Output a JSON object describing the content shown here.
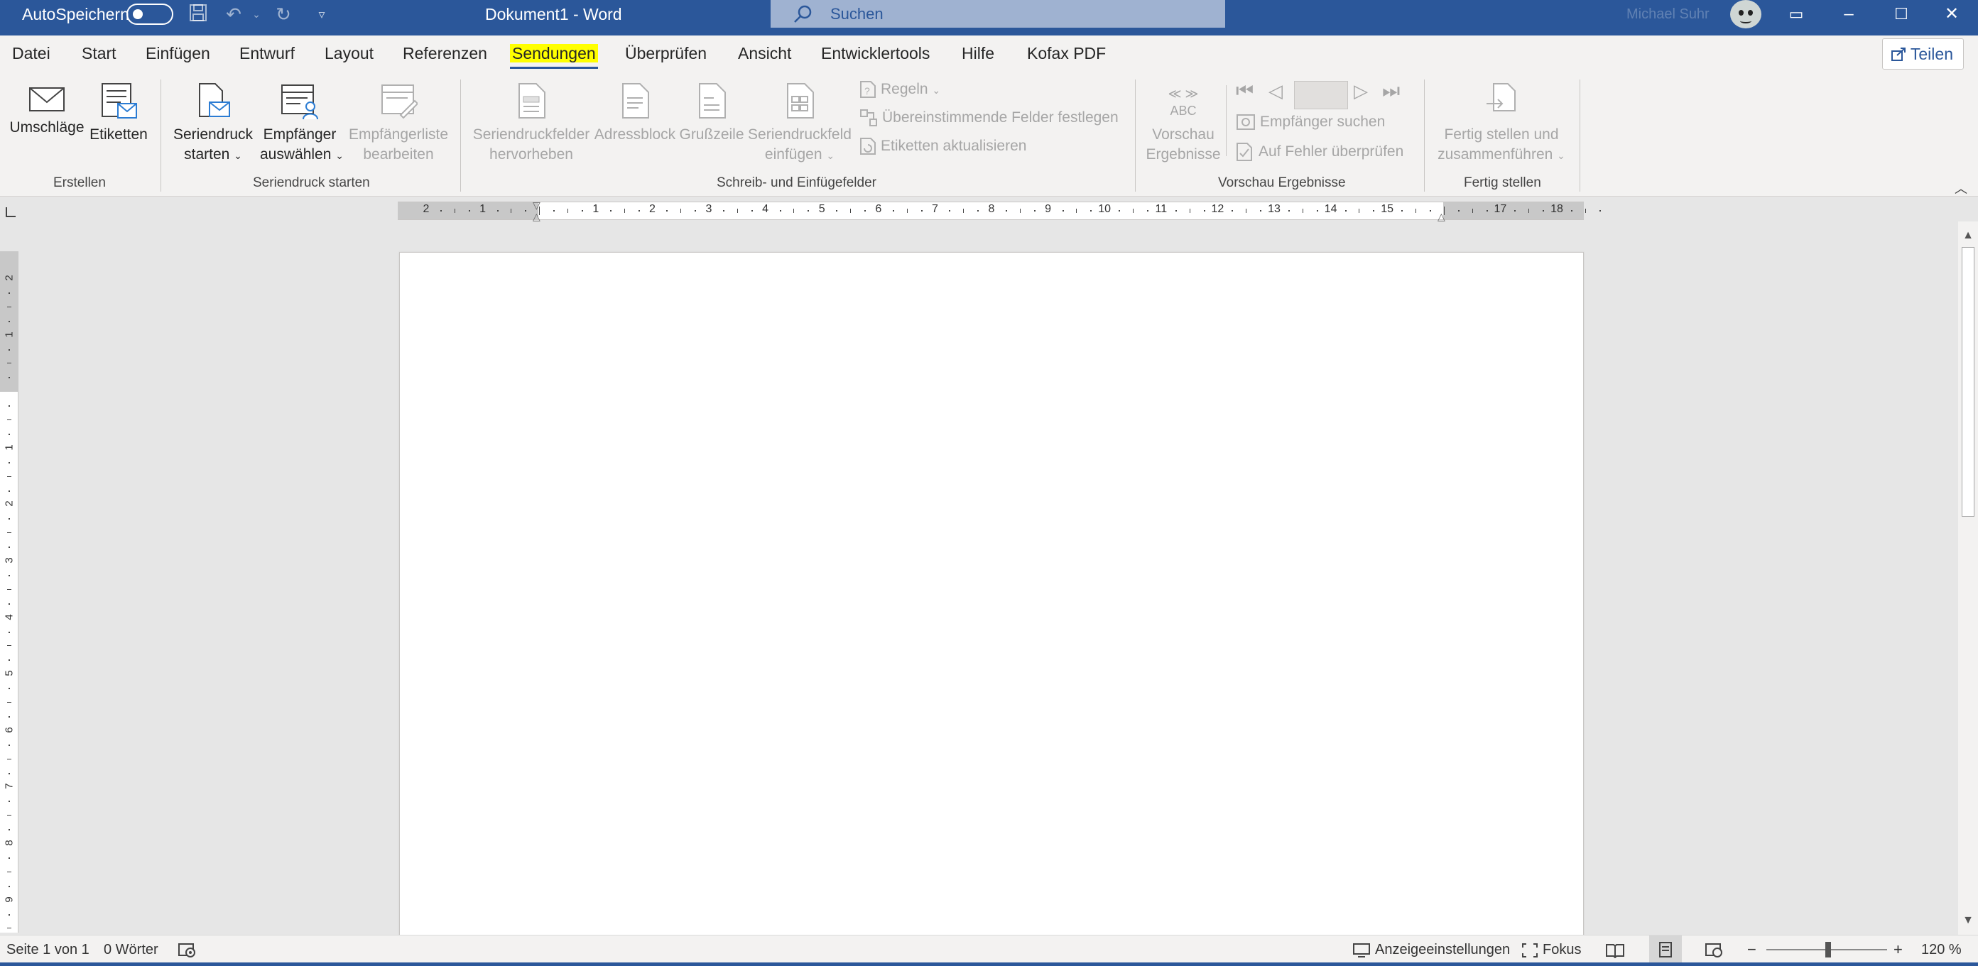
{
  "titlebar": {
    "autosave_label": "AutoSpeichern",
    "doc_title": "Dokument1  -  Word",
    "search_placeholder": "Suchen",
    "user_name": "Michael Suhr",
    "icons": [
      "save-icon",
      "undo-icon",
      "redo-icon",
      "customize-qat-icon",
      "ribbon-display-icon",
      "minimize-icon",
      "maximize-icon",
      "close-icon"
    ],
    "accent": "#2b579a"
  },
  "menu": {
    "tabs": [
      "Datei",
      "Start",
      "Einfügen",
      "Entwurf",
      "Layout",
      "Referenzen",
      "Sendungen",
      "Überprüfen",
      "Ansicht",
      "Entwicklertools",
      "Hilfe",
      "Kofax PDF"
    ],
    "active": "Sendungen",
    "highlight_color": "#ffff00",
    "share_label": "Teilen"
  },
  "ribbon": {
    "groups": {
      "erstellen": "Erstellen",
      "seriendruck_starten": "Seriendruck starten",
      "schreib": "Schreib- und Einfügefelder",
      "vorschau": "Vorschau Ergebnisse",
      "fertig": "Fertig stellen"
    },
    "buttons": {
      "umschlaege": "Umschläge",
      "etiketten": "Etiketten",
      "seriendruck_starten_1": "Seriendruck",
      "seriendruck_starten_2": "starten",
      "empfaenger_auswaehlen_1": "Empfänger",
      "empfaenger_auswaehlen_2": "auswählen",
      "empfaengerliste_1": "Empfängerliste",
      "empfaengerliste_2": "bearbeiten",
      "hervorheben_1": "Seriendruckfelder",
      "hervorheben_2": "hervorheben",
      "adressblock": "Adressblock",
      "grusszeile": "Grußzeile",
      "einfuegen_1": "Seriendruckfeld",
      "einfuegen_2": "einfügen",
      "regeln": "Regeln",
      "felder_festlegen": "Übereinstimmende Felder festlegen",
      "etiketten_aktualisieren": "Etiketten aktualisieren",
      "vorschau_abc": "ABC",
      "vorschau_1": "Vorschau",
      "vorschau_2": "Ergebnisse",
      "empfaenger_suchen": "Empfänger suchen",
      "fehler_pruefen": "Auf Fehler überprüfen",
      "fertig_1": "Fertig stellen und",
      "fertig_2": "zusammenführen"
    }
  },
  "ruler": {
    "h_labels": [
      "2",
      "1",
      "",
      "1",
      "2",
      "3",
      "4",
      "5",
      "6",
      "7",
      "8",
      "9",
      "10",
      "11",
      "12",
      "13",
      "14",
      "15",
      "",
      "17",
      "18"
    ],
    "v_labels": [
      "2",
      "1",
      "",
      "1",
      "2",
      "3",
      "4",
      "5",
      "6",
      "7",
      "8",
      "9"
    ]
  },
  "status": {
    "page": "Seite 1 von 1",
    "words": "0 Wörter",
    "display_settings": "Anzeigeeinstellungen",
    "focus": "Fokus",
    "zoom": "120 %",
    "zoom_minus": "−",
    "zoom_plus": "+"
  }
}
